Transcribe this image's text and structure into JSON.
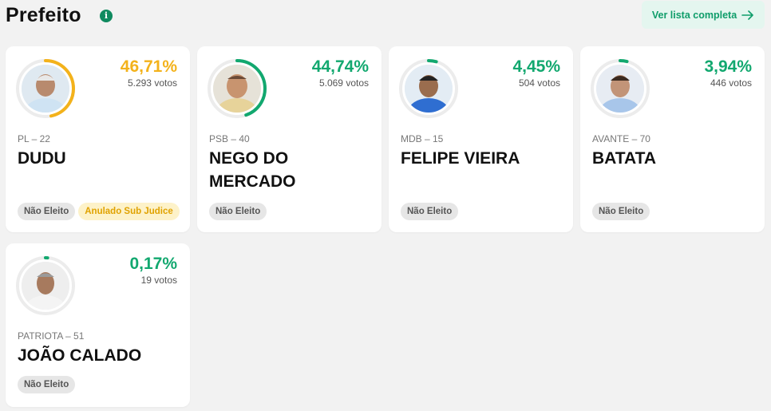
{
  "header": {
    "title": "Prefeito",
    "info_glyph": "i",
    "full_list_label": "Ver lista completa"
  },
  "colors": {
    "accent_green": "#12a86f",
    "accent_yellow": "#f3b21b",
    "badge_grey": "#e6e6e6",
    "badge_yellow": "#fdf2c9"
  },
  "candidates": [
    {
      "pct": "46,71%",
      "pct_value": 46.71,
      "votes": "5.293 votos",
      "party": "PL – 22",
      "name": "DUDU",
      "ring_color": "#f3b21b",
      "badges": [
        "Não Eleito",
        "Anulado Sub Judice"
      ],
      "photo_icon": "candidate-photo"
    },
    {
      "pct": "44,74%",
      "pct_value": 44.74,
      "votes": "5.069 votos",
      "party": "PSB – 40",
      "name": "NEGO DO MERCADO",
      "ring_color": "#12a86f",
      "badges": [
        "Não Eleito"
      ],
      "photo_icon": "candidate-photo"
    },
    {
      "pct": "4,45%",
      "pct_value": 4.45,
      "votes": "504 votos",
      "party": "MDB – 15",
      "name": "FELIPE VIEIRA",
      "ring_color": "#12a86f",
      "badges": [
        "Não Eleito"
      ],
      "photo_icon": "candidate-photo"
    },
    {
      "pct": "3,94%",
      "pct_value": 3.94,
      "votes": "446 votos",
      "party": "AVANTE – 70",
      "name": "BATATA",
      "ring_color": "#12a86f",
      "badges": [
        "Não Eleito"
      ],
      "photo_icon": "candidate-photo"
    },
    {
      "pct": "0,17%",
      "pct_value": 0.17,
      "votes": "19 votos",
      "party": "PATRIOTA – 51",
      "name": "JOÃO CALADO",
      "ring_color": "#12a86f",
      "badges": [
        "Não Eleito"
      ],
      "photo_icon": "candidate-photo"
    }
  ]
}
